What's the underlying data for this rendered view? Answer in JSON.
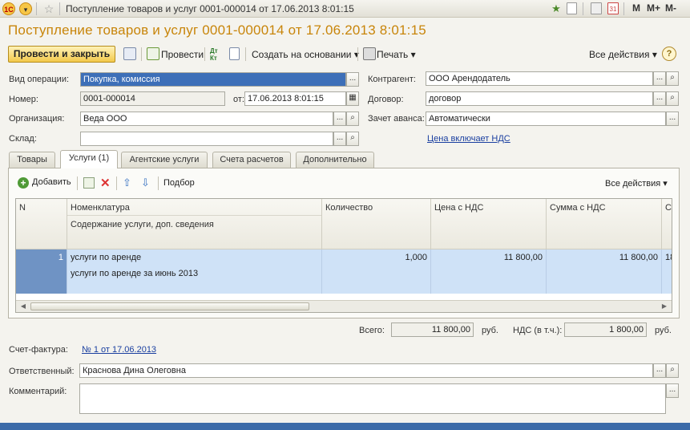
{
  "window": {
    "title": "Поступление товаров и услуг 0001-000014 от 17.06.2013 8:01:15",
    "right_buttons": [
      "M",
      "M+",
      "M-"
    ]
  },
  "header": {
    "title": "Поступление товаров и услуг 0001-000014 от 17.06.2013 8:01:15"
  },
  "toolbar": {
    "post_close": "Провести и закрыть",
    "post": "Провести",
    "dtkt": "Дт Кт",
    "create_based": "Создать на основании",
    "print": "Печать",
    "all_actions": "Все действия",
    "help": "?"
  },
  "form": {
    "operation_label": "Вид операции:",
    "operation_value": "Покупка, комиссия",
    "number_label": "Номер:",
    "number_value": "0001-000014",
    "date_label": "от:",
    "date_value": "17.06.2013  8:01:15",
    "org_label": "Организация:",
    "org_value": "Веда ООО",
    "warehouse_label": "Склад:",
    "warehouse_value": "",
    "contractor_label": "Контрагент:",
    "contractor_value": "ООО Арендодатель",
    "contract_label": "Договор:",
    "contract_value": "договор",
    "advance_label": "Зачет аванса:",
    "advance_value": "Автоматически",
    "vat_link": "Цена включает НДС"
  },
  "tabs": [
    {
      "label": "Товары"
    },
    {
      "label": "Услуги (1)"
    },
    {
      "label": "Агентские услуги"
    },
    {
      "label": "Счета расчетов"
    },
    {
      "label": "Дополнительно"
    }
  ],
  "table_toolbar": {
    "add": "Добавить",
    "selection": "Подбор",
    "all_actions": "Все действия"
  },
  "table": {
    "columns": {
      "n": "N",
      "nomenclature": "Номенклатура",
      "content": "Содержание услуги, доп. сведения",
      "quantity": "Количество",
      "price": "Цена с НДС",
      "sum": "Сумма с НДС",
      "next": "С"
    },
    "rows": [
      {
        "n": "1",
        "nomenclature": "услуги по аренде",
        "content": "услуги по аренде за июнь 2013",
        "quantity": "1,000",
        "price": "11 800,00",
        "sum": "11 800,00",
        "next": "18"
      }
    ]
  },
  "totals": {
    "total_label": "Всего:",
    "total_value": "11 800,00",
    "currency": "руб.",
    "vat_label": "НДС (в т.ч.):",
    "vat_value": "1 800,00",
    "vat_currency": "руб."
  },
  "invoice": {
    "label": "Счет-фактура:",
    "link": "№ 1 от 17.06.2013"
  },
  "responsible": {
    "label": "Ответственный:",
    "value": "Краснова Дина Олеговна"
  },
  "comment": {
    "label": "Комментарий:",
    "value": ""
  },
  "colors": {
    "title": "#c8850a",
    "selection": "#3d6fb8",
    "row_highlight": "#cfe2f7",
    "link": "#1a3fa0"
  }
}
